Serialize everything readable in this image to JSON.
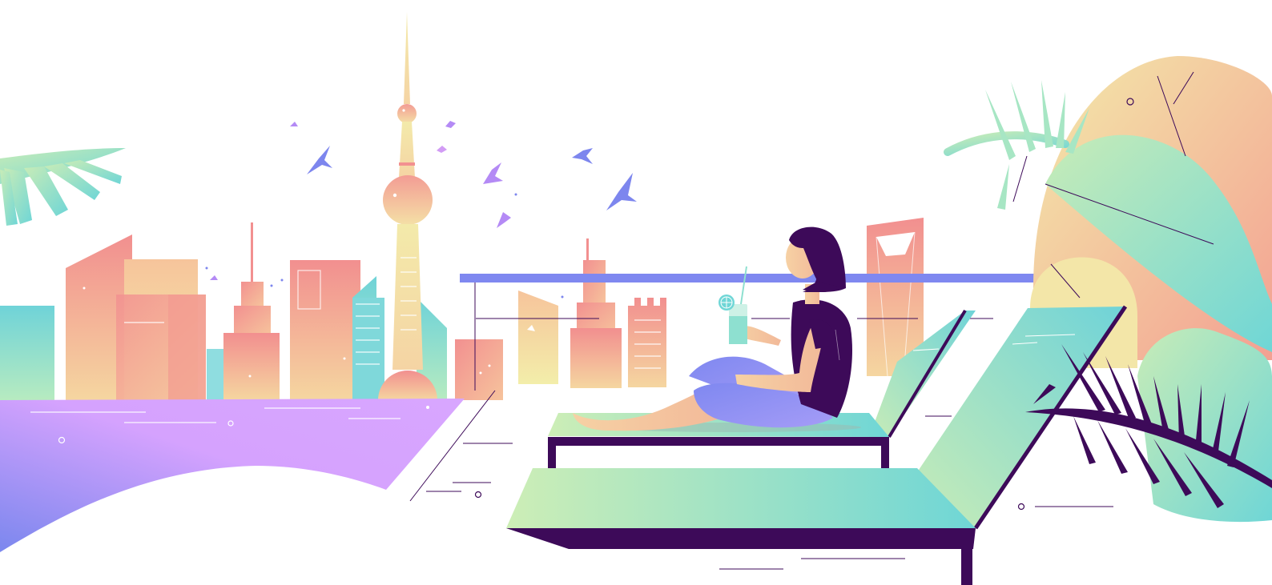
{
  "scene": {
    "colors": {
      "background": "#ffffff",
      "coral": "#f28f8f",
      "peach": "#f5c79c",
      "butter": "#f3ecaa",
      "mint": "#c8ecb6",
      "aqua": "#6fd6d6",
      "lavender": "#d6a2ff",
      "periwinkle": "#7d86ee",
      "deep_purple": "#3d0a59",
      "skin": "#f4c8a0",
      "rail": "#7f88f0"
    },
    "icons": {
      "bird": "bird-icon",
      "palm": "palm-leaf-icon",
      "drink": "cocktail-icon"
    }
  }
}
